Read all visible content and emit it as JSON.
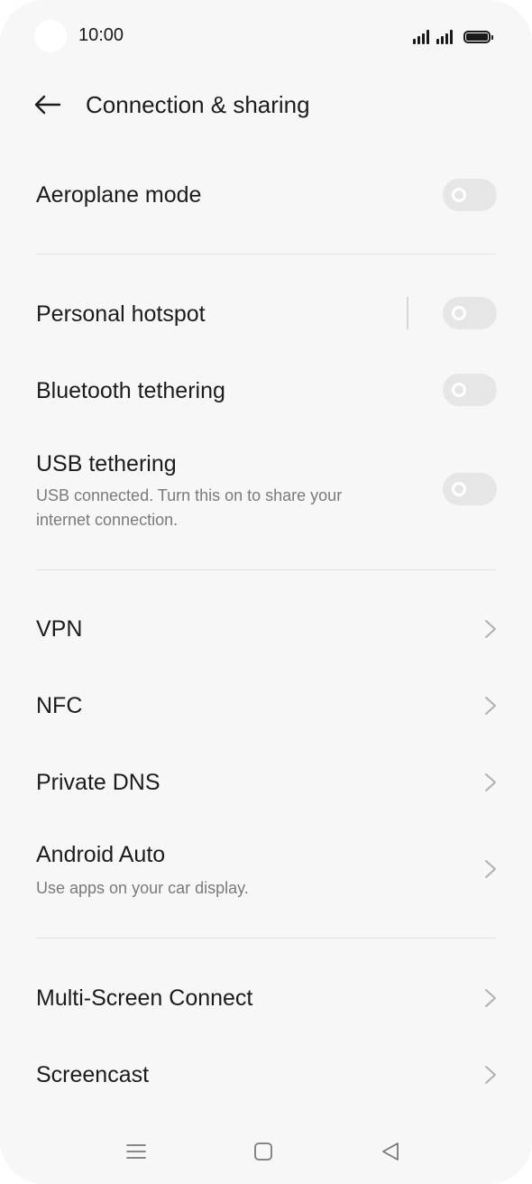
{
  "status_bar": {
    "time": "10:00"
  },
  "header": {
    "title": "Connection & sharing",
    "back_icon": "arrow-left-icon"
  },
  "settings": {
    "aeroplane_mode": {
      "label": "Aeroplane mode",
      "enabled": false
    },
    "personal_hotspot": {
      "label": "Personal hotspot",
      "enabled": false
    },
    "bluetooth_tethering": {
      "label": "Bluetooth tethering",
      "enabled": false
    },
    "usb_tethering": {
      "label": "USB tethering",
      "subtitle": "USB connected. Turn this on to share your internet connection.",
      "enabled": false
    },
    "vpn": {
      "label": "VPN"
    },
    "nfc": {
      "label": "NFC"
    },
    "private_dns": {
      "label": "Private DNS"
    },
    "android_auto": {
      "label": "Android Auto",
      "subtitle": "Use apps on your car display."
    },
    "multi_screen_connect": {
      "label": "Multi-Screen Connect"
    },
    "screencast": {
      "label": "Screencast"
    }
  },
  "nav_bar": {
    "icons": [
      "menu-icon",
      "home-icon",
      "back-triangle-icon"
    ]
  },
  "colors": {
    "background": "#f7f7f7",
    "toggle_off": "#e6e6e6",
    "text_primary": "#1c1c1c",
    "text_secondary": "#7a7a7a"
  }
}
